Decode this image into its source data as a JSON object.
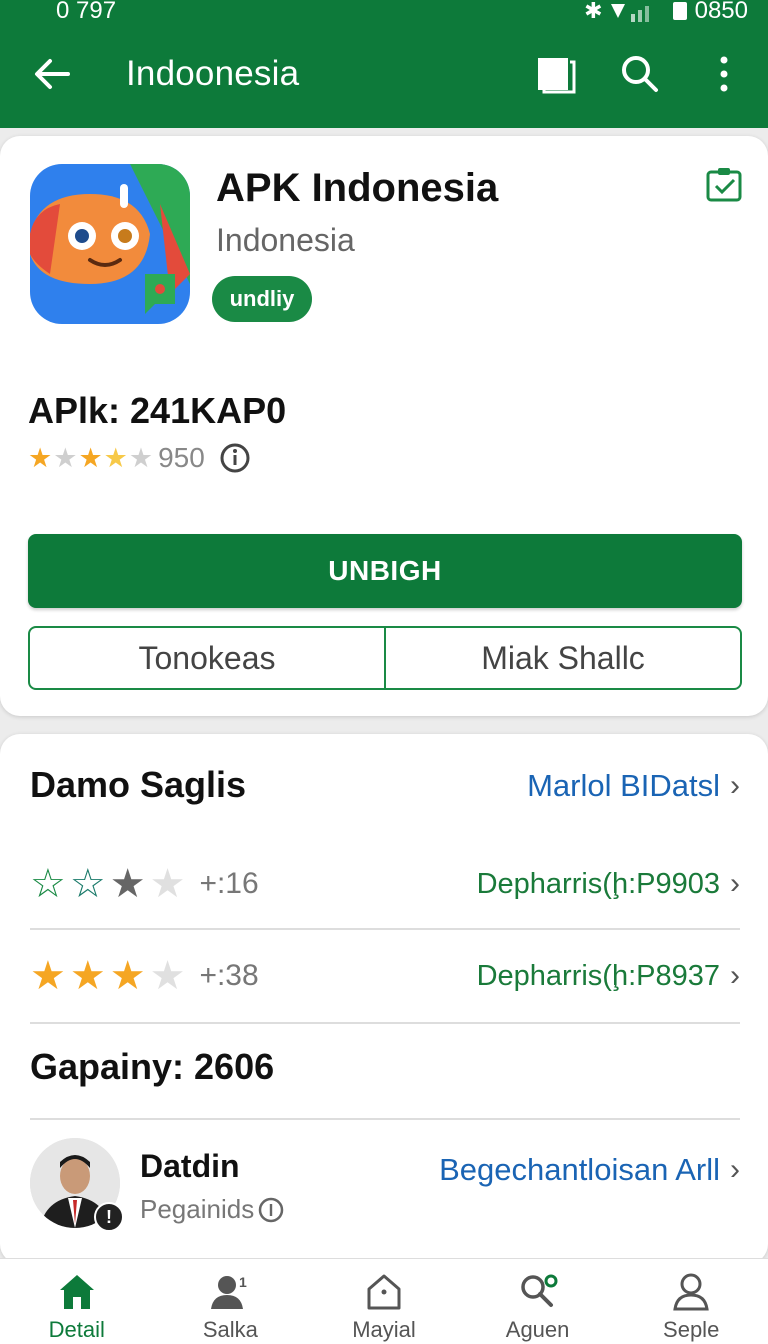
{
  "status_bar": {
    "time": "0 797",
    "right_text": "0850"
  },
  "toolbar": {
    "title": "Indoonesia"
  },
  "app": {
    "title": "APK Indonesia",
    "subtitle": "Indonesia",
    "badge": "undliy",
    "version": "APlk: 241KAP0",
    "rating_count": "950",
    "primary_button": "UNBIGH",
    "segments": [
      "Tonokeas",
      "Miak Shallc"
    ]
  },
  "details": {
    "section_title": "Damo Saglis",
    "section_link": "Marlol BIDatsl",
    "rows": [
      {
        "value": "+:16",
        "link": "Depharris(ḩ:P9903"
      },
      {
        "value": "+:38",
        "link": "Depharris(ḩ:P8937"
      }
    ],
    "company": "Gapainy: 2606",
    "developer": {
      "name": "Datdin",
      "subtitle": "Pegainids",
      "link": "Begechantloisan Arll"
    }
  },
  "bottom_nav": [
    {
      "label": "Detail",
      "icon": "home-icon",
      "active": true
    },
    {
      "label": "Salka",
      "icon": "person-icon",
      "active": false
    },
    {
      "label": "Mayial",
      "icon": "house-outline-icon",
      "active": false
    },
    {
      "label": "Aguen",
      "icon": "search-user-icon",
      "active": false
    },
    {
      "label": "Seple",
      "icon": "profile-icon",
      "active": false
    }
  ],
  "colors": {
    "primary": "#0d7a3a",
    "link_blue": "#1a64b4",
    "link_green": "#1a7a3a",
    "star_gold": "#f5a623"
  }
}
